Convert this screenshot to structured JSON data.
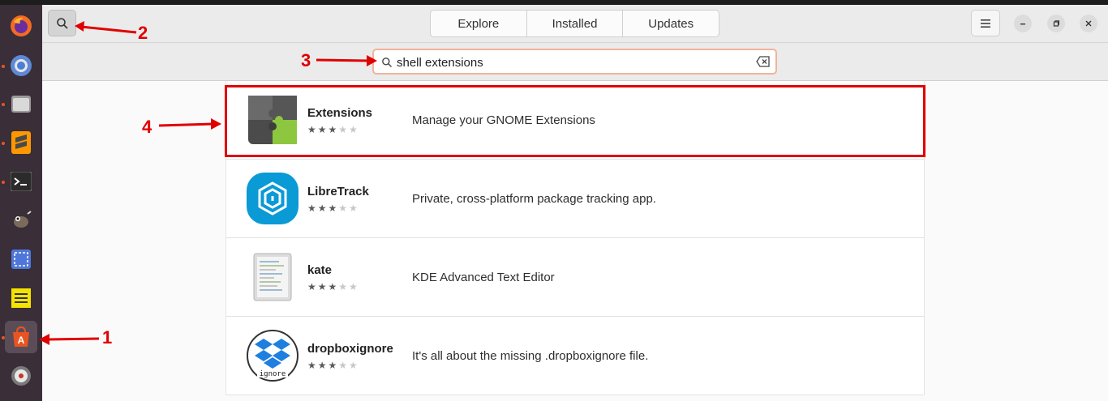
{
  "header": {
    "tabs": [
      {
        "label": "Explore"
      },
      {
        "label": "Installed"
      },
      {
        "label": "Updates"
      }
    ]
  },
  "search": {
    "value": "shell extensions"
  },
  "results": [
    {
      "name": "Extensions",
      "description": "Manage your GNOME Extensions",
      "rating": 3,
      "icon": "puzzle-icon"
    },
    {
      "name": "LibreTrack",
      "description": "Private, cross-platform package tracking app.",
      "rating": 3,
      "icon": "libretrack-icon"
    },
    {
      "name": "kate",
      "description": "KDE Advanced Text Editor",
      "rating": 3,
      "icon": "kate-icon"
    },
    {
      "name": "dropboxignore",
      "description": "It's all about the missing .dropboxignore file.",
      "rating": 3,
      "icon": "dropbox-icon"
    }
  ],
  "annotations": {
    "one": "1",
    "two": "2",
    "three": "3",
    "four": "4"
  },
  "dock": {
    "items": [
      "firefox-icon",
      "chrome-icon",
      "files-icon",
      "sublime-text-icon",
      "terminal-icon",
      "gimp-icon",
      "screenshot-icon",
      "notes-icon",
      "app-center-icon",
      "disk-icon"
    ]
  },
  "colors": {
    "annotation": "#e00000",
    "dock": "#3a2e38",
    "accent": "#e95420"
  }
}
